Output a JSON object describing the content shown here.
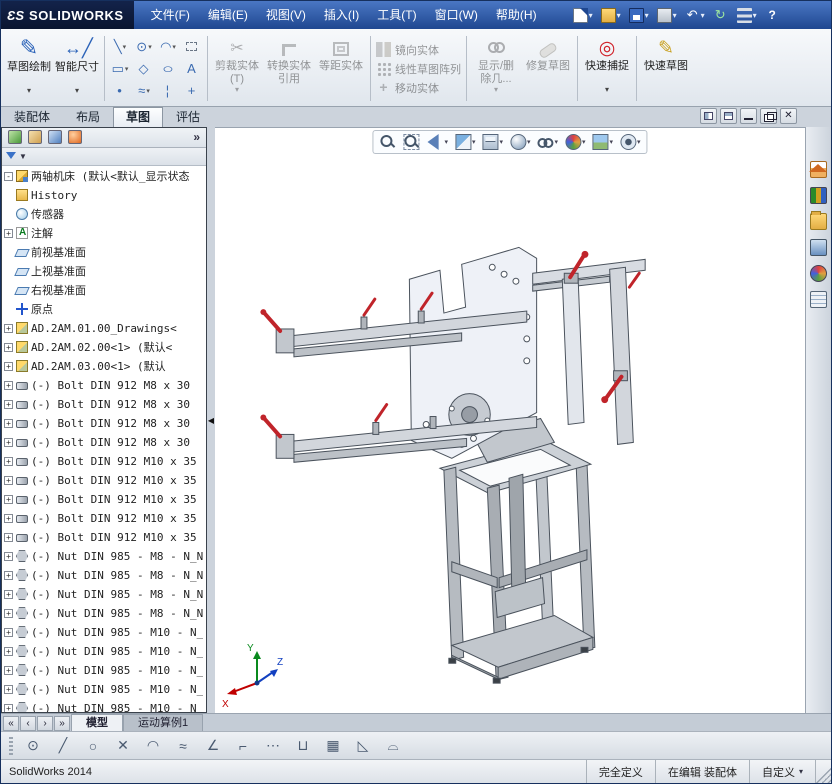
{
  "titlebar": {
    "brand_mark": "ƐS",
    "brand": "SOLIDWORKS",
    "menus": [
      {
        "label": "文件(F)"
      },
      {
        "label": "编辑(E)"
      },
      {
        "label": "视图(V)"
      },
      {
        "label": "插入(I)"
      },
      {
        "label": "工具(T)"
      },
      {
        "label": "窗口(W)"
      },
      {
        "label": "帮助(H)"
      }
    ],
    "quick": [
      {
        "name": "new-document-icon",
        "cls": "qi-new",
        "glyph": "",
        "dd": "▾"
      },
      {
        "name": "open-icon",
        "cls": "qi-open",
        "glyph": "",
        "dd": "▾"
      },
      {
        "name": "save-icon",
        "cls": "qi-save",
        "glyph": "",
        "dd": "▾"
      },
      {
        "name": "print-icon",
        "cls": "qi-print",
        "glyph": "",
        "dd": "▾"
      },
      {
        "name": "undo-icon",
        "cls": "qi-undo",
        "glyph": "↶",
        "dd": "▾"
      },
      {
        "name": "rebuild-icon",
        "cls": "qi-rebuild",
        "glyph": "↻",
        "dd": ""
      },
      {
        "name": "options-icon",
        "cls": "qi-options",
        "glyph": "",
        "dd": "▾"
      },
      {
        "name": "help-icon",
        "cls": "qi-help",
        "glyph": "?",
        "dd": ""
      }
    ]
  },
  "ribbon": {
    "sketch": "草图绘制",
    "smart_dimension": "智能尺寸",
    "trim": "剪裁实体(T)",
    "convert": "转换实体引用",
    "offset": "等距实体",
    "mirror": "镜向实体",
    "linear_pattern": "线性草图阵列",
    "move": "移动实体",
    "relations": "显示/删除几...",
    "repair": "修复草图",
    "quick_snaps": "快速捕捉",
    "rapid_sketch": "快速草图",
    "grid": [
      {
        "name": "line-icon",
        "glyph": "╲",
        "dd": "▾",
        "cls": ""
      },
      {
        "name": "circle-icon",
        "glyph": "⊙",
        "dd": "▾",
        "cls": ""
      },
      {
        "name": "arc-icon",
        "glyph": "◠",
        "dd": "▾",
        "cls": ""
      },
      {
        "name": "corner-rectangle-icon",
        "glyph": "",
        "dd": "",
        "cls": "g-dash"
      },
      {
        "name": "rectangle-icon",
        "glyph": "▭",
        "dd": "▾",
        "cls": ""
      },
      {
        "name": "polygon-icon",
        "glyph": "◇",
        "dd": "",
        "cls": ""
      },
      {
        "name": "ellipse-icon",
        "glyph": "○",
        "dd": "",
        "cls": "g-wide"
      },
      {
        "name": "text-icon",
        "glyph": "A",
        "dd": "",
        "cls": ""
      },
      {
        "name": "point-icon",
        "glyph": "•",
        "dd": "",
        "cls": ""
      },
      {
        "name": "spline-icon",
        "glyph": "≈",
        "dd": "▾",
        "cls": ""
      },
      {
        "name": "centerline-icon",
        "glyph": "¦",
        "dd": "",
        "cls": ""
      },
      {
        "name": "construction-geometry-icon",
        "glyph": "+",
        "dd": "",
        "cls": ""
      }
    ]
  },
  "cmd_tabs": {
    "items": [
      {
        "label": "装配体",
        "cls": ""
      },
      {
        "label": "布局",
        "cls": ""
      },
      {
        "label": "草图",
        "cls": "active"
      },
      {
        "label": "评估",
        "cls": ""
      }
    ]
  },
  "mdi": {
    "items": [
      {
        "name": "viewport-split-vertical-icon",
        "cls": "mdi-split1",
        "glyph": ""
      },
      {
        "name": "viewport-split-horizontal-icon",
        "cls": "mdi-split2",
        "glyph": ""
      },
      {
        "name": "minimize-document-icon",
        "cls": "mdi-min",
        "glyph": ""
      },
      {
        "name": "restore-document-icon",
        "cls": "mdi-restore",
        "glyph": ""
      },
      {
        "name": "close-document-icon",
        "cls": "mdi-close",
        "glyph": "✕"
      }
    ]
  },
  "headsup": {
    "icons": [
      {
        "name": "zoom-fit-icon",
        "cls": "hu-zoomfit",
        "dd": ""
      },
      {
        "name": "zoom-area-icon",
        "cls": "hu-zoomarea",
        "dd": ""
      },
      {
        "name": "previous-view-icon",
        "cls": "hu-prev",
        "dd": "▾"
      },
      {
        "name": "section-view-icon",
        "cls": "hu-section",
        "dd": "▾"
      },
      {
        "name": "view-orientation-icon",
        "cls": "hu-orient",
        "dd": "▾"
      },
      {
        "name": "display-style-icon",
        "cls": "hu-style",
        "dd": "▾"
      },
      {
        "name": "hide-show-items-icon",
        "cls": "hu-hideshow",
        "dd": "▾"
      },
      {
        "name": "edit-appearance-icon",
        "cls": "hu-appearance",
        "dd": "▾"
      },
      {
        "name": "apply-scene-icon",
        "cls": "hu-scene",
        "dd": "▾"
      },
      {
        "name": "view-settings-icon",
        "cls": "hu-settings",
        "dd": "▾"
      }
    ]
  },
  "fm_panel": {
    "tabs": [
      {
        "name": "featuremanager-tab-icon",
        "cls": "fmtab-tree"
      },
      {
        "name": "propertymanager-tab-icon",
        "cls": "fmtab-prop"
      },
      {
        "name": "configurationmanager-tab-icon",
        "cls": "fmtab-cfg"
      },
      {
        "name": "displaymanager-tab-icon",
        "cls": "fmtab-disp"
      }
    ],
    "overflow": "»",
    "filter_dd": "▼",
    "root": {
      "label": "两轴机床 (默认<默认_显示状态"
    },
    "items": [
      {
        "exp": "exp-none",
        "ic": "ti-hist",
        "label": "History"
      },
      {
        "exp": "exp-none",
        "ic": "ti-sens",
        "label": "传感器"
      },
      {
        "exp": "exp-plus",
        "ic": "ti-ann",
        "label": "注解"
      },
      {
        "exp": "exp-none",
        "ic": "ti-plane",
        "label": "前视基准面"
      },
      {
        "exp": "exp-none",
        "ic": "ti-plane",
        "label": "上视基准面"
      },
      {
        "exp": "exp-none",
        "ic": "ti-plane",
        "label": "右视基准面"
      },
      {
        "exp": "exp-none",
        "ic": "ti-origin",
        "label": "原点"
      },
      {
        "exp": "exp-plus",
        "ic": "ti-part",
        "label": "AD.2AM.01.00_Drawings<"
      },
      {
        "exp": "exp-plus",
        "ic": "ti-part",
        "label": "AD.2AM.02.00<1> (默认<"
      },
      {
        "exp": "exp-plus",
        "ic": "ti-part",
        "label": "AD.2AM.03.00<1> (默认"
      },
      {
        "exp": "exp-plus",
        "ic": "ti-bolt",
        "label": "(-) Bolt DIN 912 M8 x 30"
      },
      {
        "exp": "exp-plus",
        "ic": "ti-bolt",
        "label": "(-) Bolt DIN 912 M8 x 30"
      },
      {
        "exp": "exp-plus",
        "ic": "ti-bolt",
        "label": "(-) Bolt DIN 912 M8 x 30"
      },
      {
        "exp": "exp-plus",
        "ic": "ti-bolt",
        "label": "(-) Bolt DIN 912 M8 x 30"
      },
      {
        "exp": "exp-plus",
        "ic": "ti-bolt",
        "label": "(-) Bolt DIN 912 M10 x 35"
      },
      {
        "exp": "exp-plus",
        "ic": "ti-bolt",
        "label": "(-) Bolt DIN 912 M10 x 35"
      },
      {
        "exp": "exp-plus",
        "ic": "ti-bolt",
        "label": "(-) Bolt DIN 912 M10 x 35"
      },
      {
        "exp": "exp-plus",
        "ic": "ti-bolt",
        "label": "(-) Bolt DIN 912 M10 x 35"
      },
      {
        "exp": "exp-plus",
        "ic": "ti-bolt",
        "label": "(-) Bolt DIN 912 M10 x 35"
      },
      {
        "exp": "exp-plus",
        "ic": "ti-nut",
        "label": "(-) Nut DIN 985 - M8 - N_N"
      },
      {
        "exp": "exp-plus",
        "ic": "ti-nut",
        "label": "(-) Nut DIN 985 - M8 - N_N"
      },
      {
        "exp": "exp-plus",
        "ic": "ti-nut",
        "label": "(-) Nut DIN 985 - M8 - N_N"
      },
      {
        "exp": "exp-plus",
        "ic": "ti-nut",
        "label": "(-) Nut DIN 985 - M8 - N_N"
      },
      {
        "exp": "exp-plus",
        "ic": "ti-nut",
        "label": "(-) Nut DIN 985 - M10 - N_"
      },
      {
        "exp": "exp-plus",
        "ic": "ti-nut",
        "label": "(-) Nut DIN 985 - M10 - N_"
      },
      {
        "exp": "exp-plus",
        "ic": "ti-nut",
        "label": "(-) Nut DIN 985 - M10 - N_"
      },
      {
        "exp": "exp-plus",
        "ic": "ti-nut",
        "label": "(-) Nut DIN 985 - M10 - N_"
      },
      {
        "exp": "exp-plus",
        "ic": "ti-nut",
        "label": "(-) Nut DIN 985 - M10 - N_"
      }
    ]
  },
  "viewport": {
    "triad": {
      "x": "X",
      "y": "Y",
      "z": "Z"
    }
  },
  "taskpane": {
    "items": [
      {
        "name": "resources-home-icon",
        "cls": "tp-home"
      },
      {
        "name": "design-library-icon",
        "cls": "tp-library"
      },
      {
        "name": "file-explorer-icon",
        "cls": "tp-folder"
      },
      {
        "name": "view-palette-icon",
        "cls": "tp-palette"
      },
      {
        "name": "appearances-icon",
        "cls": "tp-appearance"
      },
      {
        "name": "custom-properties-icon",
        "cls": "tp-props"
      }
    ]
  },
  "doc_tabs": {
    "nav": [
      {
        "name": "first-tab-icon",
        "glyph": "«"
      },
      {
        "name": "prev-tab-icon",
        "glyph": "‹"
      },
      {
        "name": "next-tab-icon",
        "glyph": "›"
      },
      {
        "name": "last-tab-icon",
        "glyph": "»"
      }
    ],
    "tabs": [
      {
        "label": "模型",
        "cls": "active"
      },
      {
        "label": "运动算例1",
        "cls": ""
      }
    ]
  },
  "sketch_bar": {
    "items": [
      {
        "name": "sketch-point-icon",
        "glyph": "⊙"
      },
      {
        "name": "sketch-line-icon",
        "glyph": "╱"
      },
      {
        "name": "sketch-circle-icon",
        "glyph": "○"
      },
      {
        "name": "sketch-erase-icon",
        "glyph": "✕"
      },
      {
        "name": "sketch-arc-icon",
        "glyph": "◠"
      },
      {
        "name": "sketch-spline-icon",
        "glyph": "≈"
      },
      {
        "name": "sketch-dimension-icon",
        "glyph": "∠"
      },
      {
        "name": "sketch-trim-icon",
        "glyph": "⌐"
      },
      {
        "name": "sketch-convert-icon",
        "glyph": "⋯"
      },
      {
        "name": "sketch-slot-icon",
        "glyph": "⊔"
      },
      {
        "name": "sketch-pattern-icon",
        "glyph": "▦"
      },
      {
        "name": "sketch-chamfer-icon",
        "glyph": "◺"
      },
      {
        "name": "sketch-snap-icon",
        "glyph": "⌓"
      }
    ]
  },
  "statusbar": {
    "app": "SolidWorks 2014",
    "defined": "完全定义",
    "editing": "在编辑 装配体",
    "custom": "自定义",
    "custom_dd": "▾"
  },
  "glyphs": {
    "dd": "▾",
    "splitter": "◀"
  }
}
